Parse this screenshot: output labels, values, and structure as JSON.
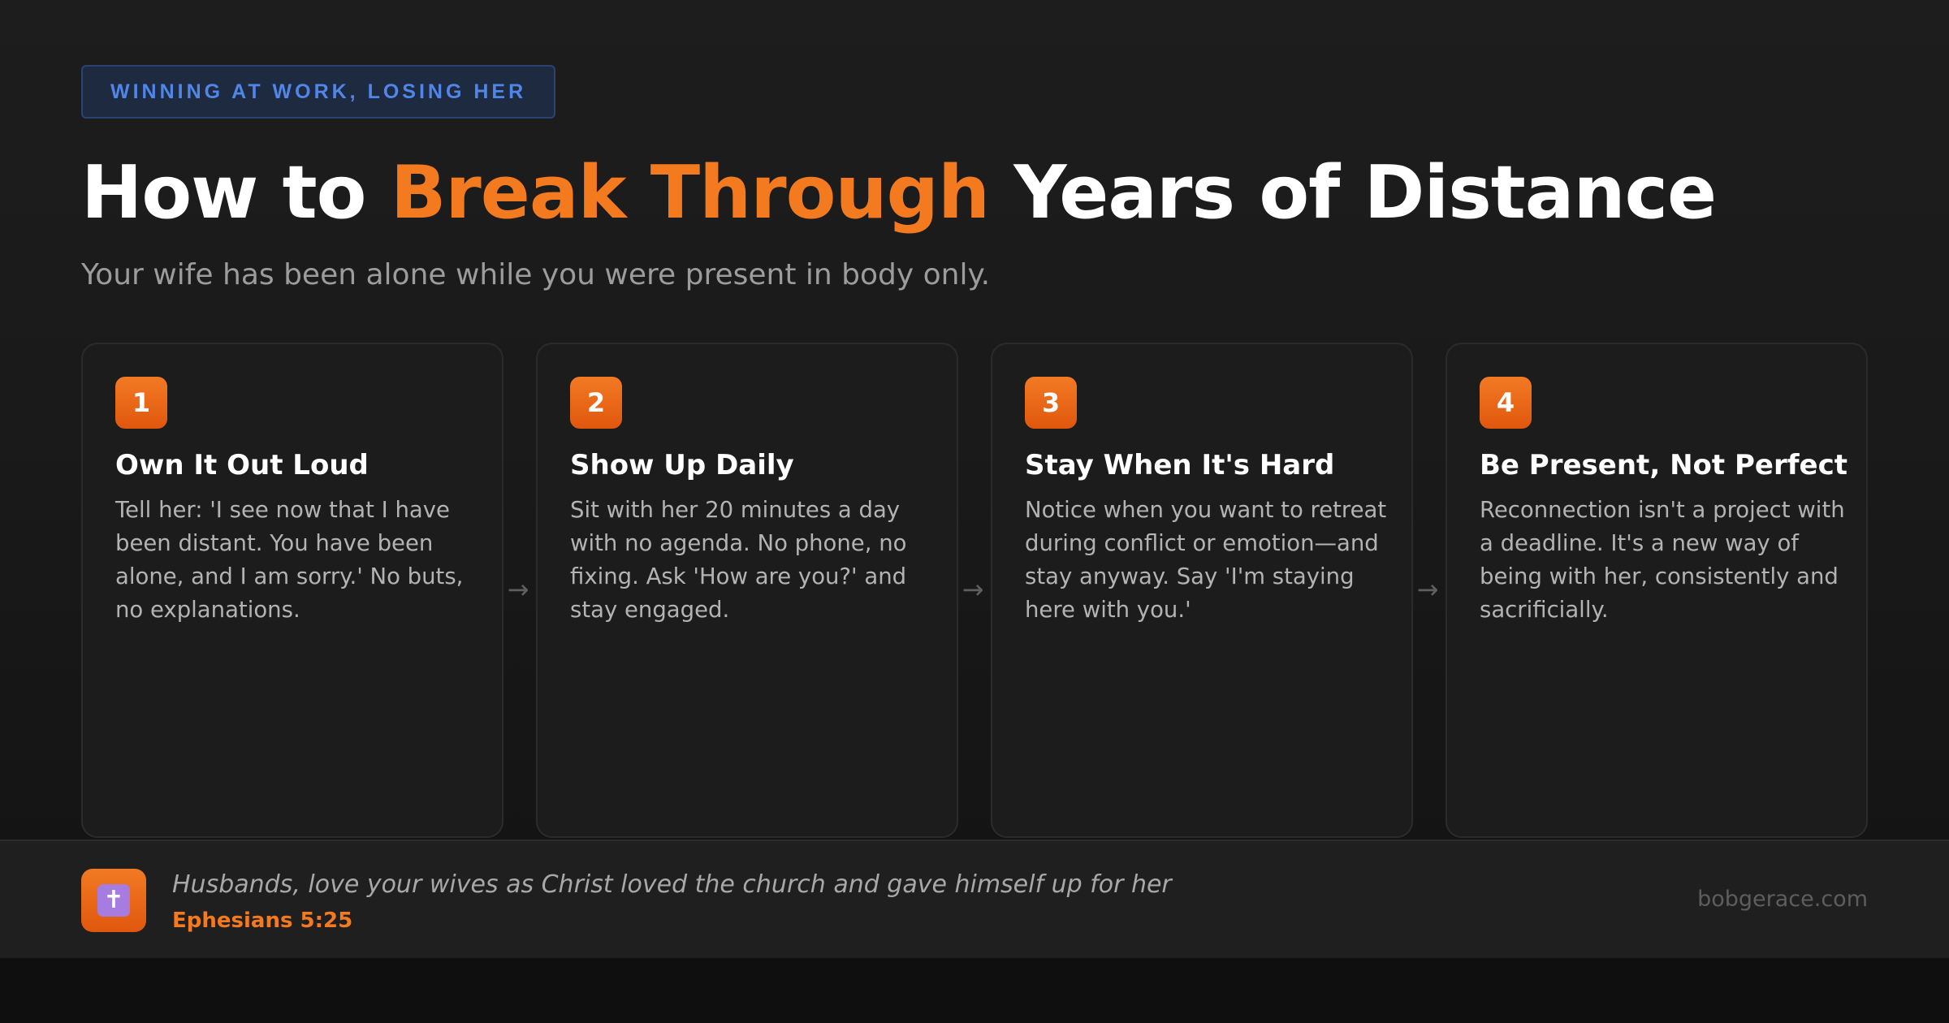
{
  "header": {
    "tag": "WINNING AT WORK, LOSING HER",
    "title_part1": "How to",
    "title_accent": "Break Through",
    "title_part2": "Years of Distance",
    "subtitle": "Your wife has been alone while you were present in body only."
  },
  "steps": [
    {
      "number": "1",
      "title": "Own It Out Loud",
      "body": "Tell her: 'I see now that I have been distant. You have been alone, and I am sorry.' No buts, no explanations."
    },
    {
      "number": "2",
      "title": "Show Up Daily",
      "body": "Sit with her 20 minutes a day with no agenda. No phone, no fixing. Ask 'How are you?' and stay engaged."
    },
    {
      "number": "3",
      "title": "Stay When It's Hard",
      "body": "Notice when you want to retreat during conflict or emotion—and stay anyway. Say 'I'm staying here with you.'"
    },
    {
      "number": "4",
      "title": "Be Present, Not Perfect",
      "body": "Reconnection isn't a project with a deadline. It's a new way of being with her, consistently and sacrificially."
    }
  ],
  "arrows": [
    "→",
    "→",
    "→"
  ],
  "footer": {
    "icon": "cross-icon",
    "icon_glyph": "✝",
    "verse": "Husbands, love your wives as Christ loved the church and gave himself up for her",
    "reference": "Ephesians 5:25",
    "website": "bobgerace.com"
  },
  "colors": {
    "accent": "#f47a20",
    "tag_text": "#4f86e8",
    "background": "#1a1a1a",
    "card": "#1c1c1c"
  }
}
